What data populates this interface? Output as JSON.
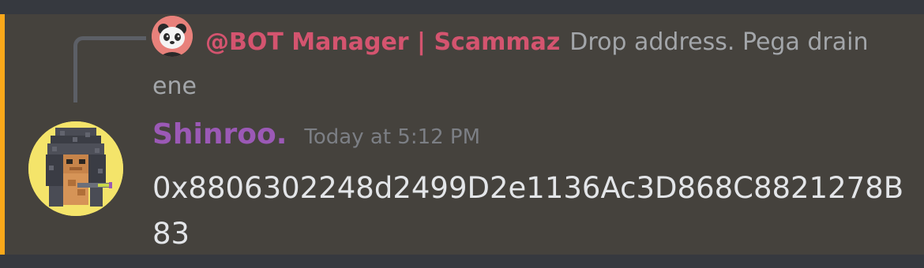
{
  "reply": {
    "author": "@BOT Manager | Scammaz",
    "text": "Drop address. Pega drain ene",
    "avatar_icon": "panda-avatar-icon"
  },
  "message": {
    "author": "Shinroo.",
    "timestamp": "Today at 5:12 PM",
    "content": "0x8806302248d2499D2e1136Ac3D868C8821278B83",
    "avatar_icon": "pixel-character-avatar-icon"
  },
  "colors": {
    "mention_bar": "#faa81a",
    "reply_author": "#d4546f",
    "author": "#9b59b6",
    "message_background": "#45423d",
    "app_background": "#36393f"
  }
}
